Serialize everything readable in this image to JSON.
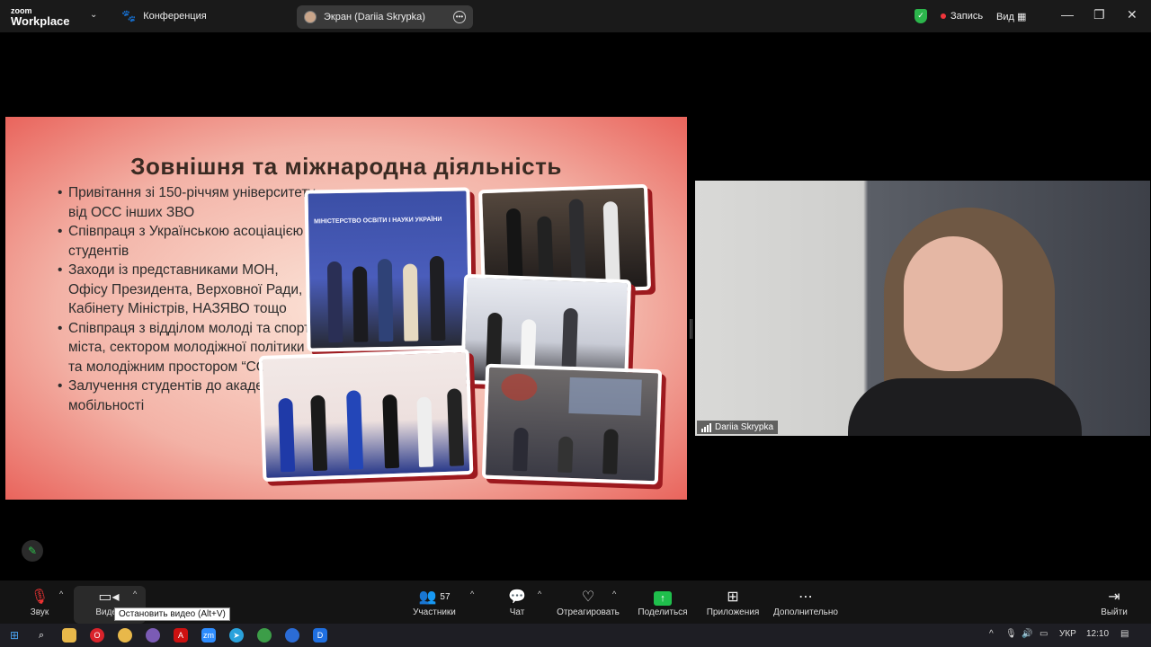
{
  "app": {
    "logo_top": "zoom",
    "logo_bottom": "Workplace"
  },
  "topbar": {
    "meeting_title": "Конференция",
    "screen_share_label": "Экран (Dariia Skrypka)",
    "record_label": "Запись",
    "view_label": "Вид"
  },
  "slide": {
    "title": "Зовнішня та міжнародна діяльність",
    "bullets": [
      "Привітання зі 150-річчям університету від ОСС інших ЗВО",
      "Співпраця з Українською асоціацією студентів",
      "Заходи із представниками МОН, Офісу Президента, Верховної Ради, Кабінету Міністрів, НАЗЯВО тощо",
      "Співпраця з відділом молоді та спорту міста, сектором молодіжної політики та молодіжним простором “COLLAB”",
      "Залучення студентів до академічної мобільності"
    ],
    "photo_banner": "МІНІСТЕРСТВО ОСВІТИ І НАУКИ УКРАЇНИ"
  },
  "video": {
    "participant_name": "Dariia Skrypka"
  },
  "toolbar": {
    "audio": "Звук",
    "video": "Видео",
    "participants": "Участники",
    "participants_count": "57",
    "chat": "Чат",
    "react": "Отреагировать",
    "share": "Поделиться",
    "apps": "Приложения",
    "more": "Дополнительно",
    "leave": "Выйти",
    "tooltip": "Остановить видео (Alt+V)"
  },
  "taskbar": {
    "language": "УКР",
    "time": "12:10"
  },
  "colors": {
    "share_green": "#1fbf4c",
    "record_red": "#f0353b",
    "slide_accent": "#9d1a1f"
  }
}
